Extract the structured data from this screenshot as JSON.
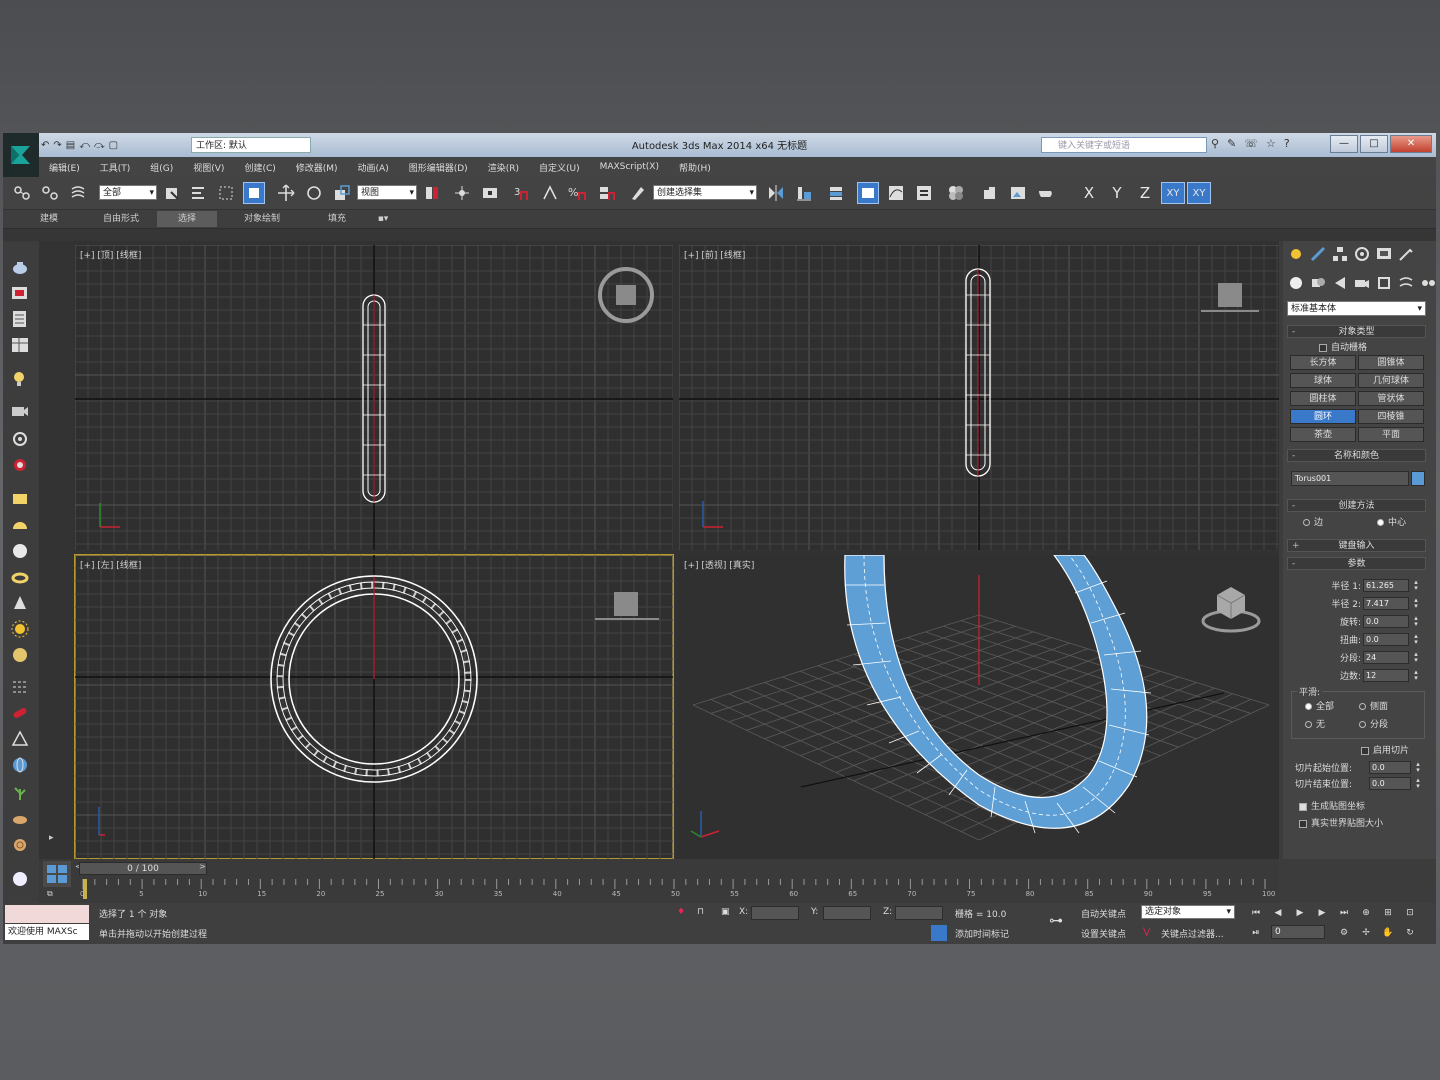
{
  "window": {
    "title": "Autodesk 3ds Max  2014 x64     无标题",
    "workspace": "工作区: 默认",
    "search_placeholder": "键入关键字或短语",
    "min": "—",
    "max": "□",
    "close": "✕"
  },
  "qat": [
    "↶",
    "↷",
    "▤",
    "⤺",
    "⤼",
    "▢"
  ],
  "menu": [
    "编辑(E)",
    "工具(T)",
    "组(G)",
    "视图(V)",
    "创建(C)",
    "修改器(M)",
    "动画(A)",
    "图形编辑器(D)",
    "渲染(R)",
    "自定义(U)",
    "MAXScript(X)",
    "帮助(H)"
  ],
  "toolbar": {
    "filter_value": "全部",
    "ref_coord": "视图",
    "named_sel": "创建选择集",
    "axis_x": "X",
    "axis_y": "Y",
    "axis_z": "Z",
    "axis_xy": "XY",
    "axis_xy2": "XY"
  },
  "ribbon_tabs": [
    "建模",
    "自由形式",
    "选择",
    "对象绘制",
    "填充"
  ],
  "viewports": {
    "top": "[+] [顶] [线框]",
    "front": "[+] [前] [线框]",
    "left": "[+] [左] [线框]",
    "perspective": "[+] [透视] [真实]"
  },
  "command_panel": {
    "category": "标准基本体",
    "object_type_title": "对象类型",
    "autogrid": "自动栅格",
    "objects": [
      "长方体",
      "圆锥体",
      "球体",
      "几何球体",
      "圆柱体",
      "管状体",
      "圆环",
      "四棱锥",
      "茶壶",
      "平面"
    ],
    "selected_object": "圆环",
    "name_color_title": "名称和颜色",
    "object_name": "Torus001",
    "creation_method_title": "创建方法",
    "creation_edge": "边",
    "creation_center": "中心",
    "keyboard_entry_title": "键盘输入",
    "params_title": "参数",
    "params": [
      {
        "label": "半径 1:",
        "value": "61.265"
      },
      {
        "label": "半径 2:",
        "value": "7.417"
      },
      {
        "label": "旋转:",
        "value": "0.0"
      },
      {
        "label": "扭曲:",
        "value": "0.0"
      },
      {
        "label": "分段:",
        "value": "24"
      },
      {
        "label": "边数:",
        "value": "12"
      }
    ],
    "smooth_title": "平滑:",
    "smooth_all": "全部",
    "smooth_sides": "侧面",
    "smooth_none": "无",
    "smooth_segments": "分段",
    "slice_on": "启用切片",
    "slice_from": "切片起始位置:",
    "slice_from_val": "0.0",
    "slice_to": "切片结束位置:",
    "slice_to_val": "0.0",
    "gen_mapping": "生成贴图坐标",
    "real_world": "真实世界贴图大小"
  },
  "timeline": {
    "frame": "0 / 100",
    "ticks": [
      "0",
      "5",
      "10",
      "15",
      "20",
      "25",
      "30",
      "35",
      "40",
      "45",
      "50",
      "55",
      "60",
      "65",
      "70",
      "75",
      "80",
      "85",
      "90",
      "95",
      "100"
    ]
  },
  "status": {
    "welcome": "欢迎使用 MAXSc",
    "selected": "选择了 1 个 对象",
    "hint": "单击并拖动以开始创建过程",
    "x": "X:",
    "y": "Y:",
    "z": "Z:",
    "grid": "栅格 = 10.0",
    "add_time_tag": "添加时间标记",
    "auto_key": "自动关键点",
    "set_key": "设置关键点",
    "key_mode": "选定对象",
    "key_filters": "关键点过滤器...",
    "frame_field": "0"
  },
  "colors": {
    "accent": "#3a78c9",
    "torus_blue": "#5b9bd5",
    "active_border": "#b6982e"
  }
}
